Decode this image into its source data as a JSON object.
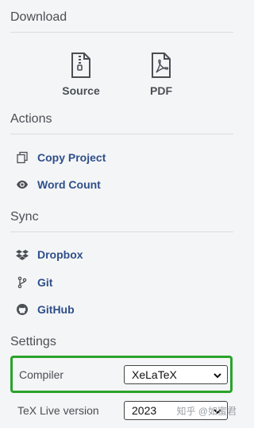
{
  "download": {
    "title": "Download",
    "source_label": "Source",
    "pdf_label": "PDF"
  },
  "actions": {
    "title": "Actions",
    "items": [
      {
        "label": "Copy Project",
        "icon": "copy-icon"
      },
      {
        "label": "Word Count",
        "icon": "eye-icon"
      }
    ]
  },
  "sync": {
    "title": "Sync",
    "items": [
      {
        "label": "Dropbox",
        "icon": "dropbox-icon"
      },
      {
        "label": "Git",
        "icon": "git-icon"
      },
      {
        "label": "GitHub",
        "icon": "github-icon"
      }
    ]
  },
  "settings": {
    "title": "Settings",
    "compiler_label": "Compiler",
    "compiler_value": "XeLaTeX",
    "texlive_label": "TeX Live version",
    "texlive_value": "2023"
  },
  "watermark": "知乎 @如蜜君",
  "colors": {
    "link": "#2e4f8b",
    "highlight": "#2aa32a",
    "background": "#f4f5f6"
  }
}
